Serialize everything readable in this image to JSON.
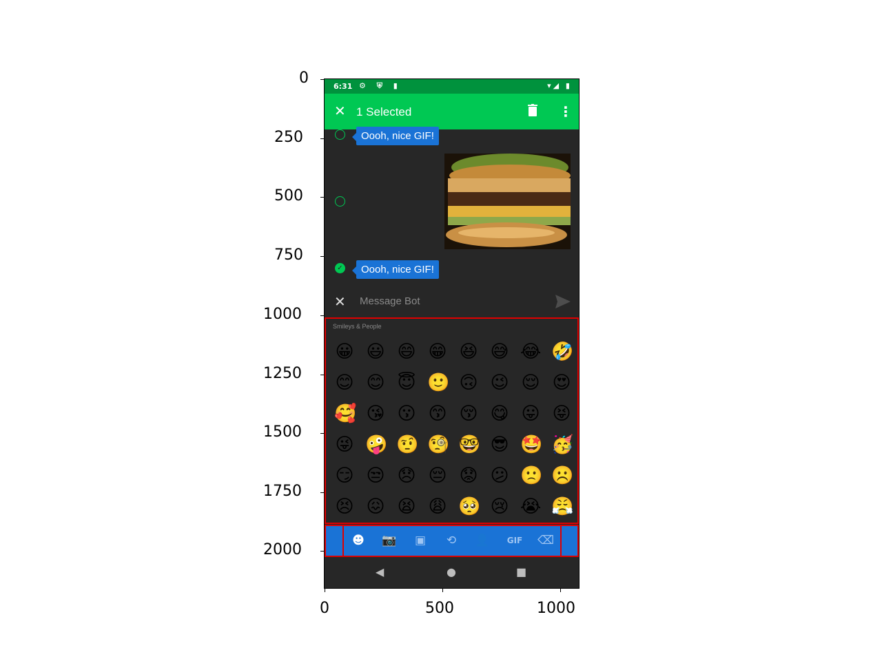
{
  "axes": {
    "y_ticks": [
      "0",
      "250",
      "500",
      "750",
      "1000",
      "1250",
      "1500",
      "1750",
      "2000"
    ],
    "x_ticks": [
      "0",
      "500",
      "1000"
    ]
  },
  "status_bar": {
    "time": "6:31",
    "left_icons": "⚙ ⛨ ▮",
    "right_icons": "▾◢ ▮"
  },
  "action_bar": {
    "close_icon": "close-icon",
    "title": "1 Selected",
    "delete_icon": "trash-icon",
    "more_icon": "more-vert-icon"
  },
  "messages": [
    {
      "type": "text",
      "text": "Oooh, nice GIF!",
      "selected": false
    },
    {
      "type": "gif",
      "selected": false
    },
    {
      "type": "text",
      "text": "Oooh, nice GIF!",
      "selected": true
    }
  ],
  "composer": {
    "placeholder": "Message Bot",
    "close_icon": "close-icon",
    "send_icon": "send-icon"
  },
  "emoji_keyboard": {
    "category": "Smileys & People",
    "rows": [
      [
        "😀",
        "😃",
        "😄",
        "😁",
        "😆",
        "😅",
        "😂",
        "🤣"
      ],
      [
        "😊",
        "😊",
        "😇",
        "🙂",
        "🙃",
        "😉",
        "😌",
        "😍"
      ],
      [
        "🥰",
        "😘",
        "😗",
        "😙",
        "😚",
        "😋",
        "😛",
        "😝"
      ],
      [
        "😜",
        "🤪",
        "🤨",
        "🧐",
        "🤓",
        "😎",
        "🤩",
        "🥳"
      ],
      [
        "😏",
        "😒",
        "😞",
        "😔",
        "😟",
        "😕",
        "🙁",
        "☹️"
      ],
      [
        "😣",
        "😖",
        "😫",
        "😩",
        "🥺",
        "😢",
        "😭",
        "😤"
      ]
    ]
  },
  "toolbar": {
    "items": [
      {
        "name": "emoji-tab-icon",
        "glyph": "☻",
        "active": true
      },
      {
        "name": "camera-tab-icon",
        "glyph": "📷",
        "active": false
      },
      {
        "name": "image-tab-icon",
        "glyph": "▣",
        "active": false
      },
      {
        "name": "recent-tab-icon",
        "glyph": "⟲",
        "active": false
      },
      {
        "name": "contact-tab-icon",
        "glyph": "👤",
        "active": false
      },
      {
        "name": "gif-tab",
        "glyph": "GIF",
        "active": false
      },
      {
        "name": "backspace-icon",
        "glyph": "⌫",
        "active": false
      }
    ]
  },
  "nav_bar": {
    "back": "◀",
    "home": "●",
    "recents": "■"
  },
  "colors": {
    "status": "#00923d",
    "actionbar": "#00c853",
    "bubble": "#1a73d6",
    "background": "#272727",
    "highlight": "#e00000"
  }
}
